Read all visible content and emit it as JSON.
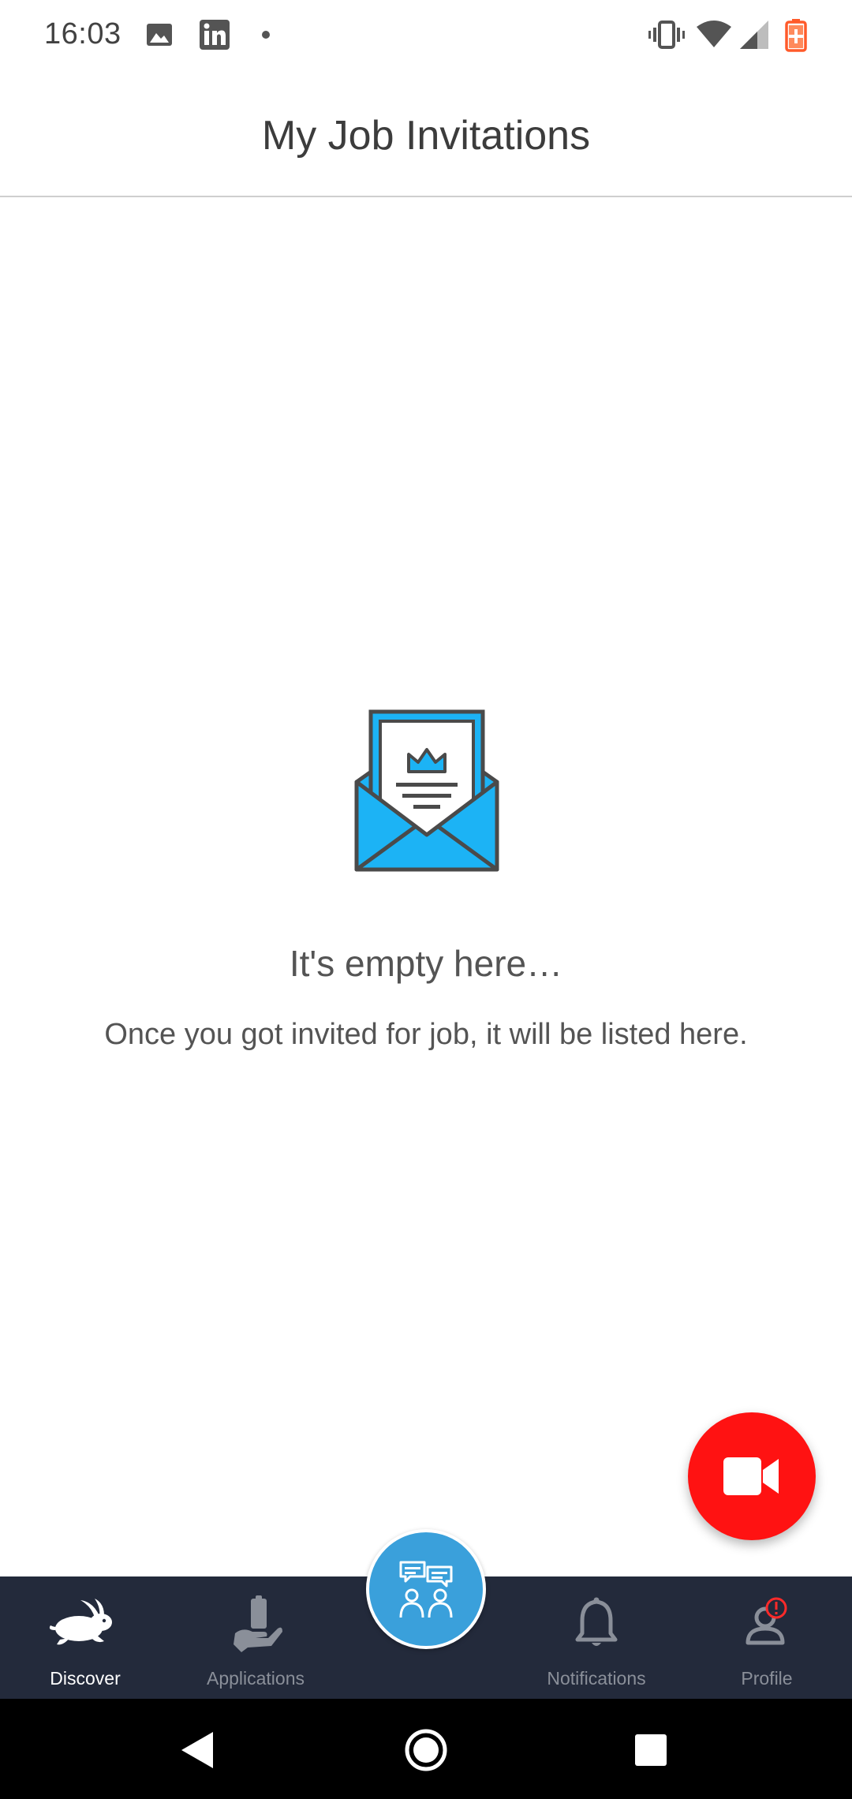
{
  "status_bar": {
    "time": "16:03",
    "left_icons": [
      "image-icon",
      "linkedin-icon",
      "dot-icon"
    ],
    "right_icons": [
      "vibrate-icon",
      "wifi-icon",
      "cellular-icon",
      "battery-charging-icon"
    ],
    "battery_color": "#ff5a2a"
  },
  "header": {
    "title": "My Job Invitations"
  },
  "empty_state": {
    "illustration": "envelope-invitation-icon",
    "title": "It's empty here…",
    "description": "Once you got invited for job, it will be listed here."
  },
  "fab": {
    "icon": "video-camera-icon",
    "color": "#ff1212"
  },
  "bottom_nav": {
    "items": [
      {
        "label": "Discover",
        "icon": "rabbit-icon",
        "active": true
      },
      {
        "label": "Applications",
        "icon": "hand-clipboard-icon",
        "active": false
      },
      {
        "label": "",
        "icon": "community-chat-icon",
        "center": true
      },
      {
        "label": "Notifications",
        "icon": "bell-icon",
        "active": false
      },
      {
        "label": "Profile",
        "icon": "profile-alert-icon",
        "active": false
      }
    ],
    "background": "#232a3b",
    "center_color": "#3aa0db"
  },
  "system_nav": {
    "buttons": [
      "back-icon",
      "home-icon",
      "recents-icon"
    ]
  }
}
